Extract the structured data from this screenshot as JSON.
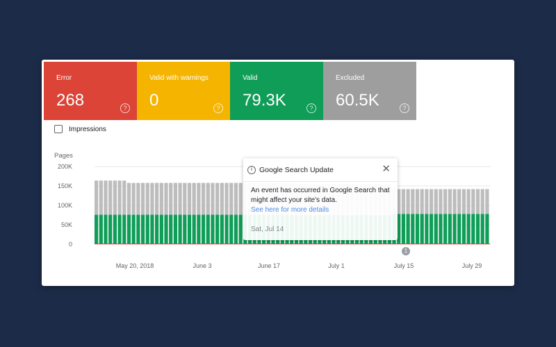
{
  "tiles": [
    {
      "label": "Error",
      "value": "268",
      "color": "#db4437"
    },
    {
      "label": "Valid with warnings",
      "value": "0",
      "color": "#f4b400"
    },
    {
      "label": "Valid",
      "value": "79.3K",
      "color": "#0f9d58"
    },
    {
      "label": "Excluded",
      "value": "60.5K",
      "color": "#9e9e9e"
    }
  ],
  "help_glyph": "?",
  "impressions_label": "Impressions",
  "chart": {
    "y_title": "Pages"
  },
  "popup": {
    "title": "Google Search Update",
    "close_glyph": "✕",
    "info_glyph": "i",
    "body": "An event has occurred in Google Search that might affect your site's data.",
    "link": "See here for more details",
    "date": "Sat, Jul 14"
  },
  "event_marker": {
    "glyph": "1",
    "date": "July 14"
  },
  "chart_data": {
    "type": "bar",
    "stacked": true,
    "ylabel": "Pages",
    "ylim": [
      0,
      200000
    ],
    "y_ticks": [
      {
        "value": 0,
        "label": "0"
      },
      {
        "value": 50000,
        "label": "50K"
      },
      {
        "value": 100000,
        "label": "100K"
      },
      {
        "value": 150000,
        "label": "150K"
      },
      {
        "value": 200000,
        "label": "200K"
      }
    ],
    "x_ticks": [
      "May 20, 2018",
      "June 3",
      "June 17",
      "July 1",
      "July 15",
      "July 29"
    ],
    "grid": true,
    "segments": [
      {
        "days": 7,
        "green": 76000,
        "gray": 88000
      },
      {
        "days": 35,
        "green": 76000,
        "gray": 82000
      },
      {
        "days": 22,
        "green": 75000,
        "gray": 80000
      },
      {
        "days": 21,
        "green": 78000,
        "gray": 64000
      }
    ],
    "colors": {
      "valid": "#0f9d58",
      "excluded": "#bdbdbd",
      "error": "#db4437"
    }
  }
}
